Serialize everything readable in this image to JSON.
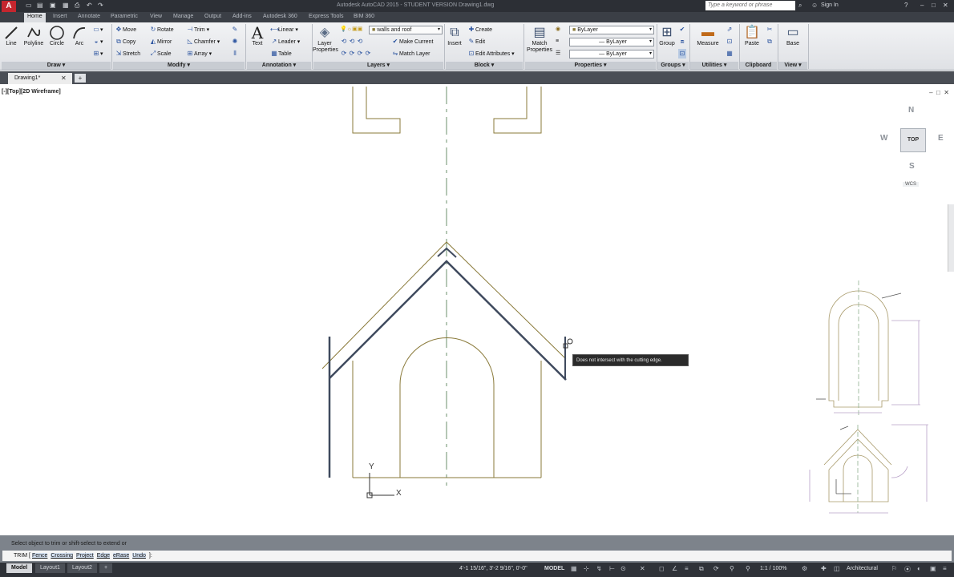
{
  "app": {
    "title": "Autodesk AutoCAD 2015 - STUDENT VERSION    Drawing1.dwg",
    "logo": "A",
    "search_placeholder": "Type a keyword or phrase",
    "sign_in": "Sign In"
  },
  "tabs": [
    "Home",
    "Insert",
    "Annotate",
    "Parametric",
    "View",
    "Manage",
    "Output",
    "Add-ins",
    "Autodesk 360",
    "Express Tools",
    "BIM 360"
  ],
  "ribbon": {
    "draw": {
      "title": "Draw",
      "line": "Line",
      "polyline": "Polyline",
      "circle": "Circle",
      "arc": "Arc"
    },
    "modify": {
      "title": "Modify",
      "move": "Move",
      "rotate": "Rotate",
      "trim": "Trim",
      "copy": "Copy",
      "mirror": "Mirror",
      "chamfer": "Chamfer",
      "stretch": "Stretch",
      "scale": "Scale",
      "array": "Array"
    },
    "annotation": {
      "title": "Annotation",
      "text": "Text",
      "linear": "Linear",
      "leader": "Leader",
      "table": "Table"
    },
    "layers": {
      "title": "Layers",
      "layer_properties": "Layer Properties",
      "current_layer": "walls and roof",
      "make_current": "Make Current",
      "match_layer": "Match Layer"
    },
    "block": {
      "title": "Block",
      "insert": "Insert",
      "create": "Create",
      "edit": "Edit",
      "edit_attributes": "Edit Attributes"
    },
    "properties": {
      "title": "Properties",
      "match_properties": "Match Properties",
      "color": "ByLayer",
      "linetype": "ByLayer",
      "lineweight": "ByLayer"
    },
    "groups": {
      "title": "Groups",
      "group": "Group"
    },
    "utilities": {
      "title": "Utilities",
      "measure": "Measure"
    },
    "clipboard": {
      "title": "Clipboard",
      "paste": "Paste"
    },
    "view": {
      "title": "View",
      "base": "Base"
    }
  },
  "file_tab": {
    "name": "Drawing1*"
  },
  "viewport": {
    "label": "[-][Top][2D Wireframe]",
    "tooltip": "Does not intersect with the cutting edge.",
    "viewcube": {
      "top": "TOP",
      "north": "N",
      "south": "S",
      "east": "E",
      "west": "W"
    },
    "wcs": "WCS",
    "ucs_x": "X",
    "ucs_y": "Y"
  },
  "command": {
    "history": "Select object to trim or shift-select to extend or",
    "prompt": "TRIM [",
    "options": [
      "Fence",
      "Crossing",
      "Project",
      "Edge",
      "eRase",
      "Undo"
    ],
    "suffix": "]:"
  },
  "statusbar": {
    "layouts": [
      "Model",
      "Layout1",
      "Layout2"
    ],
    "coords": "4'-1 15/16\", 3'-2 9/16\", 0'-0\"",
    "model": "MODEL",
    "scale": "1:1 / 100%",
    "units": "Architectural"
  },
  "colors": {
    "drawing_line": "#8a7a3a",
    "selected_line": "#3f4a5e",
    "centerline": "#6b8f6b",
    "ribbon_bg": "#e6e8eb"
  }
}
